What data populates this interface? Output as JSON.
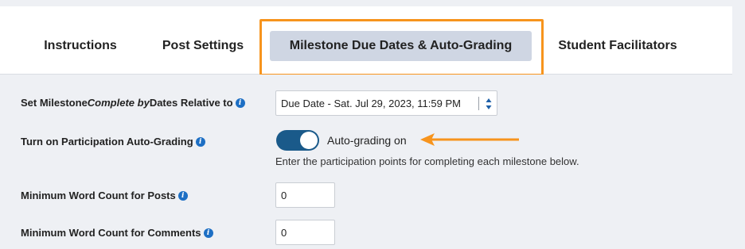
{
  "tabs": {
    "instructions": "Instructions",
    "post_settings": "Post Settings",
    "milestone": "Milestone Due Dates & Auto-Grading",
    "facilitators": "Student Facilitators"
  },
  "settings": {
    "relative_label_prefix": "Set Milestone ",
    "relative_label_em": "Complete by",
    "relative_label_suffix": " Dates Relative to",
    "relative_select_value": "Due Date - Sat. Jul 29, 2023, 11:59 PM",
    "autograde_label": "Turn on Participation Auto-Grading",
    "autograde_toggle_text": "Auto-grading on",
    "autograde_helper": "Enter the participation points for completing each milestone below.",
    "min_posts_label": "Minimum Word Count for Posts",
    "min_posts_value": "0",
    "min_comments_label": "Minimum Word Count for Comments",
    "min_comments_value": "0"
  },
  "info_glyph": "i",
  "colors": {
    "accent_orange": "#f7941d",
    "active_tab_bg": "#cfd6e3",
    "toggle_on": "#1a5a8a",
    "info_icon": "#1d6fc4"
  }
}
